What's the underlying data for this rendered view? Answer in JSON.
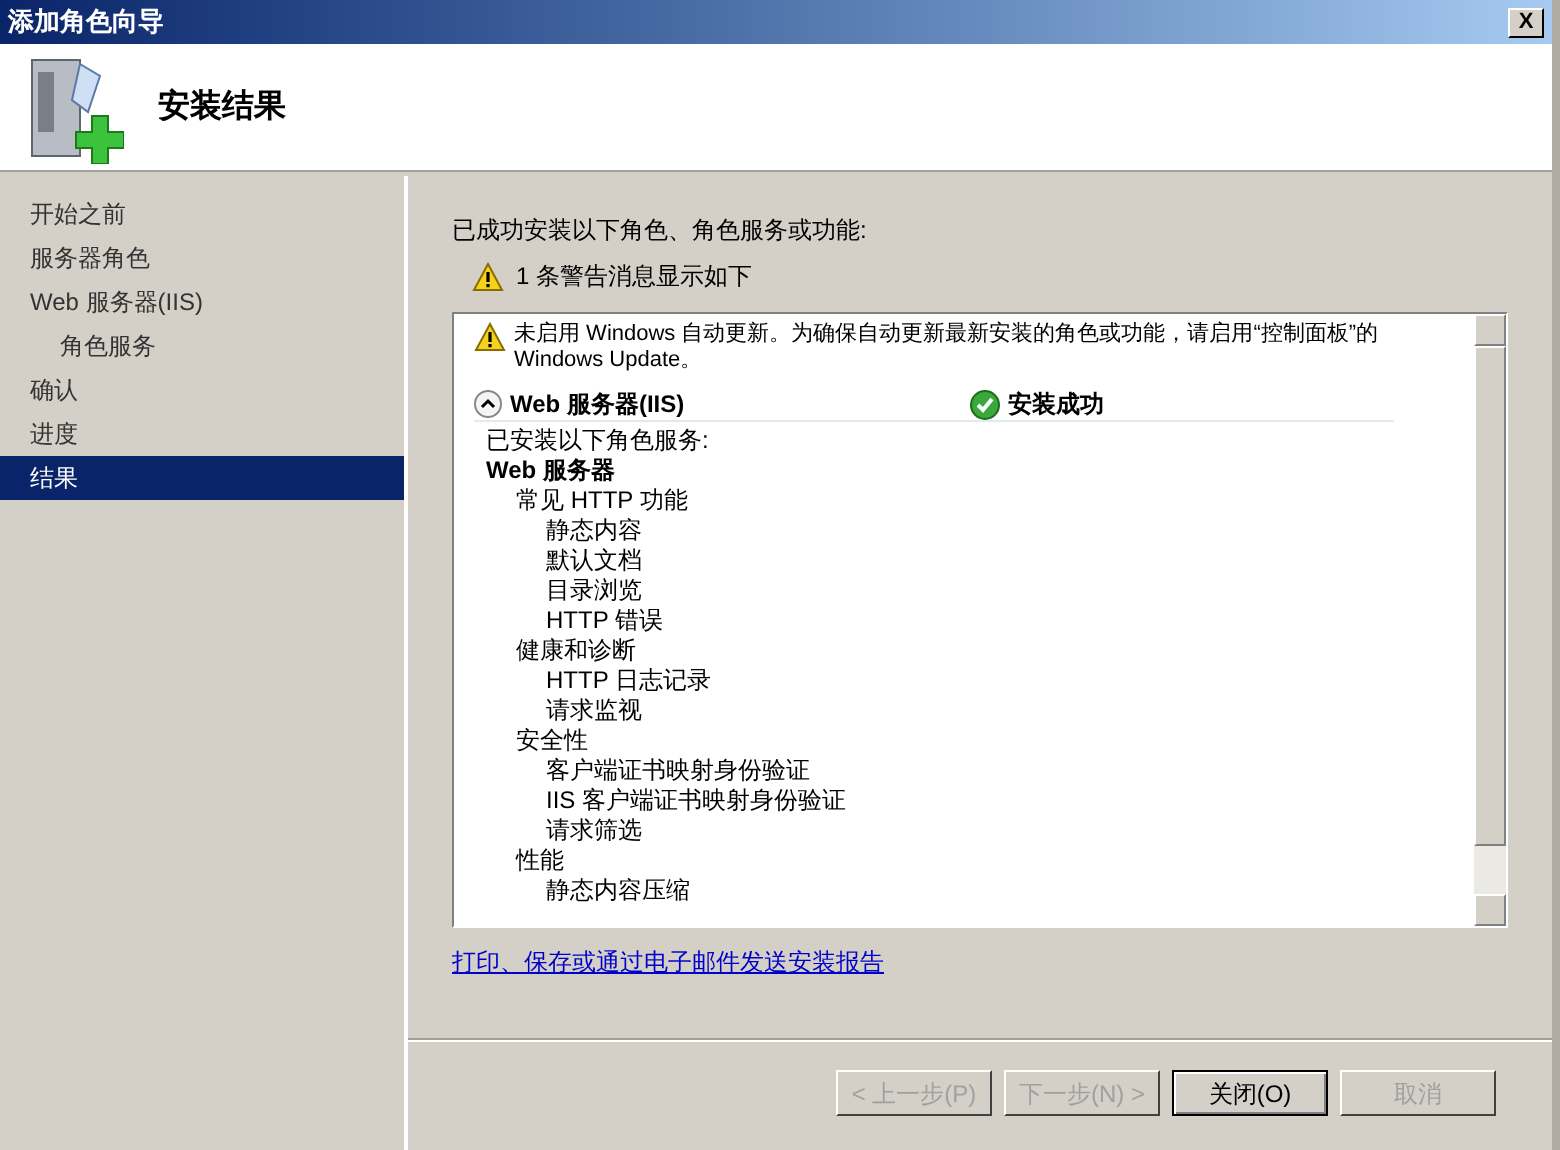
{
  "window": {
    "title": "添加角色向导",
    "close_glyph": "X"
  },
  "header": {
    "title": "安装结果"
  },
  "nav": [
    {
      "label": "开始之前",
      "selected": false
    },
    {
      "label": "服务器角色",
      "selected": false
    },
    {
      "label": "Web 服务器(IIS)",
      "selected": false,
      "children": [
        {
          "label": "角色服务",
          "selected": false
        }
      ]
    },
    {
      "label": "确认",
      "selected": false
    },
    {
      "label": "进度",
      "selected": false
    },
    {
      "label": "结果",
      "selected": true
    }
  ],
  "summary": "已成功安装以下角色、角色服务或功能:",
  "warning_count": "1 条警告消息显示如下",
  "results": {
    "warning": "未启用 Windows 自动更新。为确保自动更新最新安装的角色或功能，请启用“控制面板”的 Windows Update。",
    "role": "Web 服务器(IIS)",
    "expanded": true,
    "status": "安装成功",
    "intro": "已安装以下角色服务:",
    "tree": [
      {
        "label": "Web 服务器",
        "children": [
          {
            "label": "常见 HTTP 功能",
            "children": [
              {
                "label": "静态内容"
              },
              {
                "label": "默认文档"
              },
              {
                "label": "目录浏览"
              },
              {
                "label": "HTTP 错误"
              }
            ]
          },
          {
            "label": "健康和诊断",
            "children": [
              {
                "label": "HTTP 日志记录"
              },
              {
                "label": "请求监视"
              }
            ]
          },
          {
            "label": "安全性",
            "children": [
              {
                "label": "客户端证书映射身份验证"
              },
              {
                "label": "IIS 客户端证书映射身份验证"
              },
              {
                "label": "请求筛选"
              }
            ]
          },
          {
            "label": "性能",
            "children": [
              {
                "label": "静态内容压缩"
              }
            ]
          }
        ]
      }
    ]
  },
  "report_link": "打印、保存或通过电子邮件发送安装报告",
  "buttons": [
    {
      "label": "< 上一步(P)",
      "disabled": true,
      "default": false
    },
    {
      "label": "下一步(N) >",
      "disabled": true,
      "default": false
    },
    {
      "label": "关闭(O)",
      "disabled": false,
      "default": true
    },
    {
      "label": "取消",
      "disabled": true,
      "default": false
    }
  ]
}
